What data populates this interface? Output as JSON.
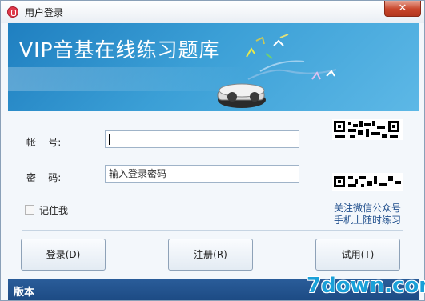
{
  "window": {
    "title": "用户登录",
    "close_label": "✕"
  },
  "banner": {
    "title": "VIP音基在线练习题库"
  },
  "form": {
    "account_label": "帐    号:",
    "account_value": "",
    "password_label": "密    码:",
    "password_placeholder": "输入登录密码",
    "remember_label": "记住我",
    "remember_checked": false
  },
  "qr": {
    "caption_line1": "关注微信公众号",
    "caption_line2": "手机上随时练习"
  },
  "buttons": {
    "login": "登录(D)",
    "register": "注册(R)",
    "trial": "试用(T)"
  },
  "footer": {
    "text": "版本"
  },
  "watermark": {
    "text": "7down.com"
  },
  "colors": {
    "banner": "#3b9fd6",
    "footer": "#1d4b84",
    "watermark": "#1aa0d8"
  }
}
